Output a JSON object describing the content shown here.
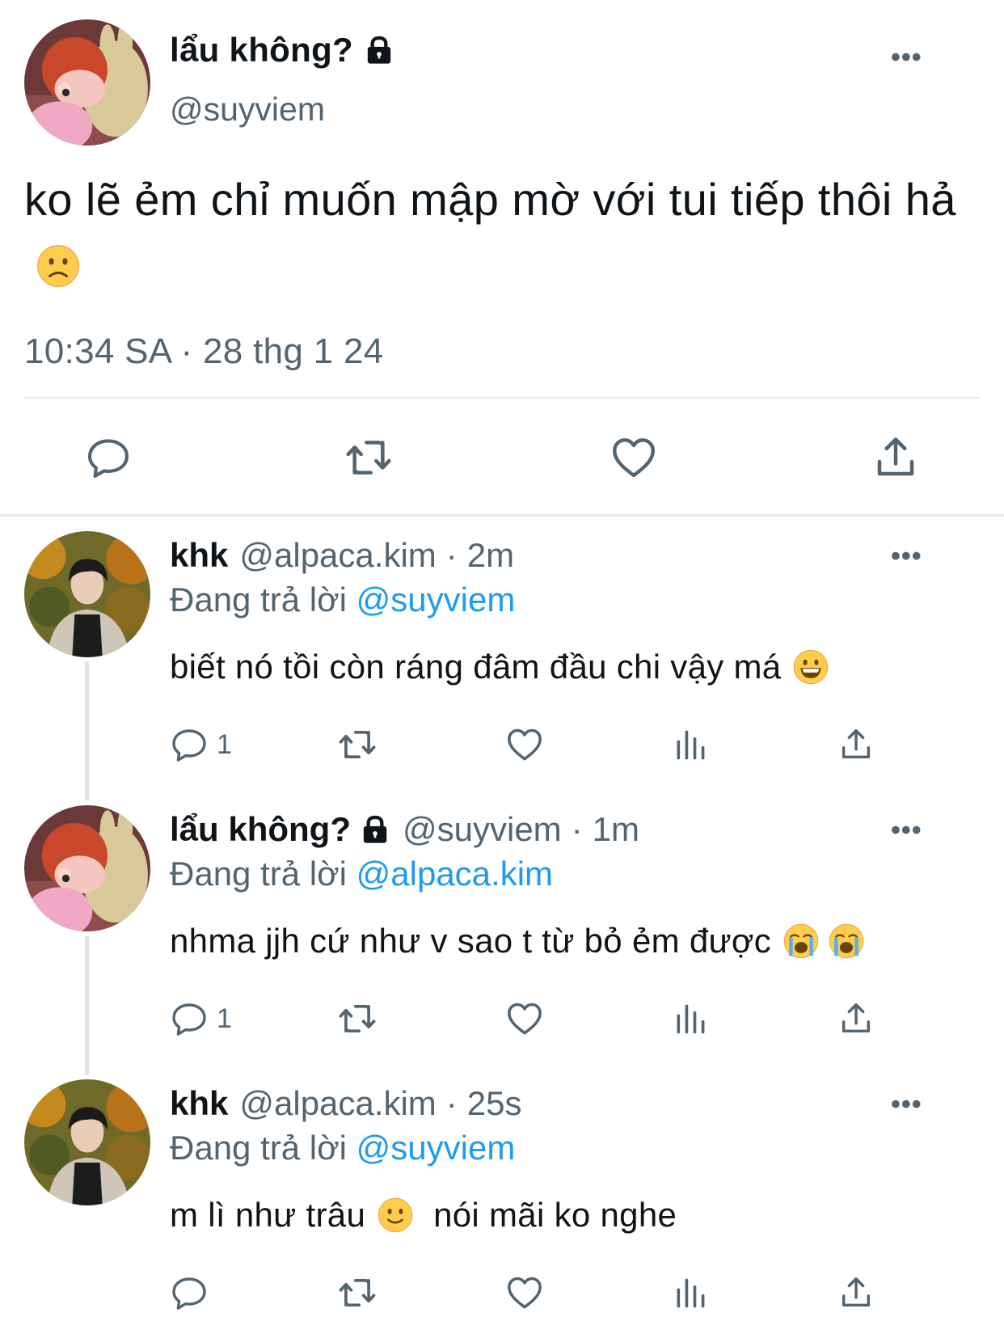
{
  "main_tweet": {
    "display_name": "lẩu không?",
    "handle": "@suyviem",
    "text": "ko lẽ ẻm chỉ muốn mập mờ với tui tiếp thôi hả",
    "timestamp": "10:34 SA · 28 thg 1 24",
    "icons": [
      "lock-icon",
      "more-icon",
      "reply-icon",
      "retweet-icon",
      "like-icon",
      "share-icon"
    ]
  },
  "replying_label": "Đang trả lời",
  "replies": [
    {
      "display_name": "khk",
      "handle": "@alpaca.kim",
      "time": "2m",
      "replying_to": "@suyviem",
      "text": "biết nó tồi còn ráng đâm đầu chi vậy má",
      "reply_count": "1"
    },
    {
      "display_name": "lẩu không?",
      "handle": "@suyviem",
      "time": "1m",
      "replying_to": "@alpaca.kim",
      "text": "nhma jjh cứ như v sao t từ bỏ ẻm được",
      "reply_count": "1"
    },
    {
      "display_name": "khk",
      "handle": "@alpaca.kim",
      "time": "25s",
      "replying_to": "@suyviem",
      "text_part1": "m lì như trâu",
      "text_part2": "nói mãi ko nghe",
      "reply_count": ""
    }
  ],
  "colors": {
    "text": "#0f1419",
    "secondary": "#536471",
    "link": "#1d9bf0",
    "divider": "#e6ecf0"
  }
}
